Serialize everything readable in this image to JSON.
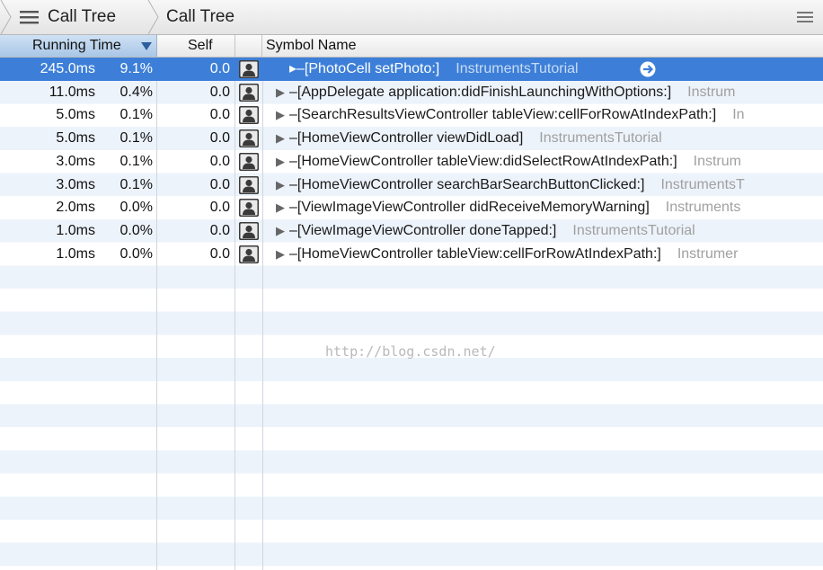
{
  "breadcrumb": {
    "items": [
      {
        "label": "Call Tree",
        "icon": "list-icon"
      },
      {
        "label": "Call Tree"
      }
    ],
    "menu_icon": "menu-icon"
  },
  "columns": {
    "running_time": "Running Time",
    "self": "Self",
    "symbol_name": "Symbol Name",
    "sort_icon": "sort-descending-icon"
  },
  "rows": [
    {
      "ms": "245.0ms",
      "pct": "9.1%",
      "self": "0.0",
      "symbol": "▸–[PhotoCell setPhoto:]",
      "library": "InstrumentsTutorial",
      "selected": true
    },
    {
      "ms": "11.0ms",
      "pct": "0.4%",
      "self": "0.0",
      "symbol": "–[AppDelegate application:didFinishLaunchingWithOptions:]",
      "library": "Instrum"
    },
    {
      "ms": "5.0ms",
      "pct": "0.1%",
      "self": "0.0",
      "symbol": "–[SearchResultsViewController tableView:cellForRowAtIndexPath:]",
      "library": "In"
    },
    {
      "ms": "5.0ms",
      "pct": "0.1%",
      "self": "0.0",
      "symbol": "–[HomeViewController viewDidLoad]",
      "library": "InstrumentsTutorial"
    },
    {
      "ms": "3.0ms",
      "pct": "0.1%",
      "self": "0.0",
      "symbol": "–[HomeViewController tableView:didSelectRowAtIndexPath:]",
      "library": "Instrum"
    },
    {
      "ms": "3.0ms",
      "pct": "0.1%",
      "self": "0.0",
      "symbol": "–[HomeViewController searchBarSearchButtonClicked:]",
      "library": "InstrumentsT"
    },
    {
      "ms": "2.0ms",
      "pct": "0.0%",
      "self": "0.0",
      "symbol": "–[ViewImageViewController didReceiveMemoryWarning]",
      "library": "Instruments"
    },
    {
      "ms": "1.0ms",
      "pct": "0.0%",
      "self": "0.0",
      "symbol": "–[ViewImageViewController doneTapped:]",
      "library": "InstrumentsTutorial"
    },
    {
      "ms": "1.0ms",
      "pct": "0.0%",
      "self": "0.0",
      "symbol": "–[HomeViewController tableView:cellForRowAtIndexPath:]",
      "library": "Instrumer"
    }
  ],
  "watermark": "http://blog.csdn.net/",
  "colors": {
    "selection": "#3d7fd8",
    "stripe": "#edf3fb",
    "header_sorted": "#a9c6e6",
    "library_text": "#a0a0a0"
  }
}
